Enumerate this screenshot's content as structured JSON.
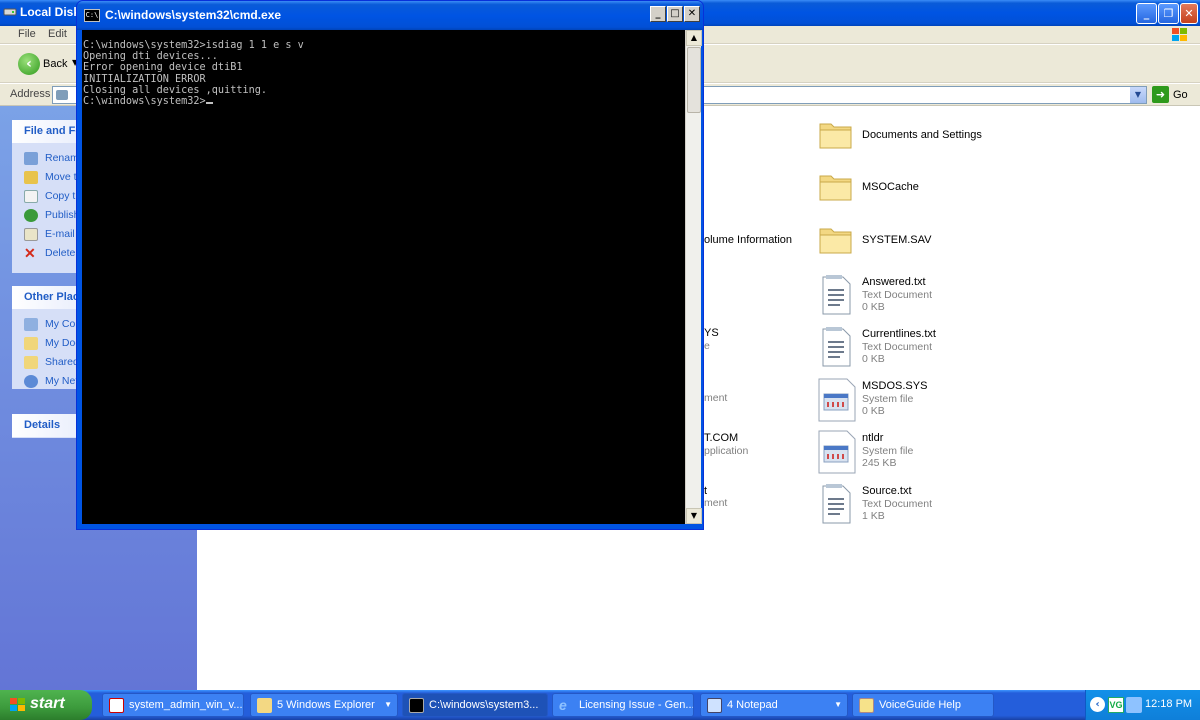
{
  "explorer": {
    "title": "Local Disk",
    "menu": [
      "File",
      "Edit"
    ],
    "toolbar": {
      "back_label": "Back"
    },
    "address": {
      "label": "Address",
      "go_label": "Go"
    },
    "task_groups": [
      {
        "title": "File and Fo",
        "items": [
          "Renam",
          "Move t",
          "Copy t",
          "Publish",
          "E-mail t",
          "Delete"
        ]
      },
      {
        "title": "Other Plac",
        "items": [
          "My Cor",
          "My Doc",
          "Shared",
          "My Net"
        ]
      },
      {
        "title": "Details",
        "items": []
      }
    ],
    "files": [
      {
        "name": "Documents and Settings",
        "kind": "folder"
      },
      {
        "name": "MSOCache",
        "kind": "folder"
      },
      {
        "name": "SYSTEM.SAV",
        "kind": "folder"
      },
      {
        "name": "Answered.txt",
        "type": "Text Document",
        "size": "0 KB",
        "kind": "text"
      },
      {
        "name": "Currentlines.txt",
        "type": "Text Document",
        "size": "0 KB",
        "kind": "text"
      },
      {
        "name": "MSDOS.SYS",
        "type": "System file",
        "size": "0 KB",
        "kind": "system"
      },
      {
        "name": "ntldr",
        "type": "System file",
        "size": "245 KB",
        "kind": "system"
      },
      {
        "name": "Source.txt",
        "type": "Text Document",
        "size": "1 KB",
        "kind": "text"
      }
    ],
    "hidden_fragments": [
      "olume Information",
      "YS",
      "e",
      "ment",
      "T.COM",
      "pplication",
      "t",
      "ment"
    ]
  },
  "cmd": {
    "title": "C:\\windows\\system32\\cmd.exe",
    "icon_text": "C:\\",
    "lines": [
      "C:\\windows\\system32>isdiag 1 1 e s v",
      "Opening dti devices...",
      "Error opening device dtiB1",
      "INITIALIZATION ERROR",
      "Closing all devices ,quitting.",
      "",
      "C:\\windows\\system32>"
    ]
  },
  "taskbar": {
    "start_label": "start",
    "buttons": [
      {
        "label": "system_admin_win_v...",
        "icon": "pdf-icon"
      },
      {
        "label": "5 Windows Explorer",
        "icon": "folder-icon"
      },
      {
        "label": "C:\\windows\\system3...",
        "icon": "cmd-icon"
      },
      {
        "label": "Licensing Issue - Gen...",
        "icon": "ie-icon"
      },
      {
        "label": "4 Notepad",
        "icon": "notepad-icon"
      },
      {
        "label": "VoiceGuide Help",
        "icon": "help-icon"
      }
    ],
    "tray_badge": "VG",
    "clock": "12:18 PM"
  }
}
